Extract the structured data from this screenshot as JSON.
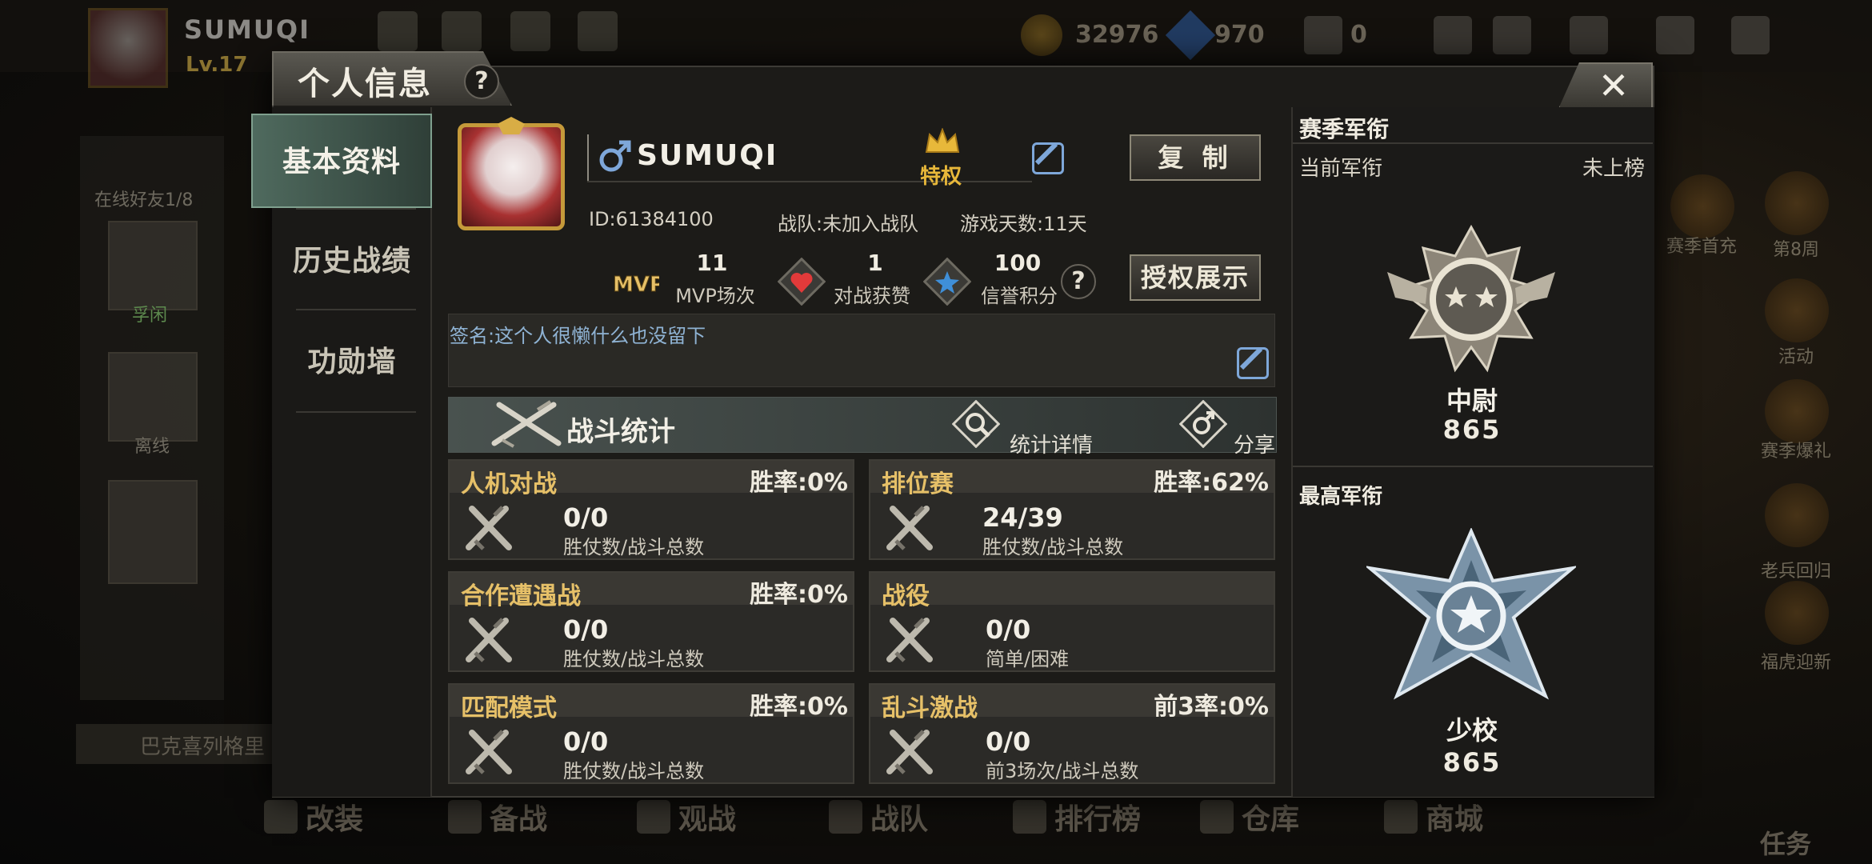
{
  "background": {
    "player_name": "SUMUQI",
    "level": "Lv.17",
    "gold": "32976",
    "diamonds": "970",
    "cards": "0",
    "online_friends": "在线好友1/8",
    "friend_labels": [
      "孚闲",
      "离线"
    ],
    "chat_preview": "巴克喜列格里",
    "right_events": [
      "赛季首充",
      "第8周",
      "活动",
      "赛季爆礼",
      "老兵回归",
      "福虎迎新"
    ],
    "bottom_nav": [
      "改装",
      "备战",
      "观战",
      "战队",
      "排行榜",
      "仓库",
      "商城"
    ],
    "task_label": "任务"
  },
  "modal": {
    "title": "个人信息",
    "help": "?",
    "close": "✕"
  },
  "tabs": [
    "基本资料",
    "历史战绩",
    "功勋墙"
  ],
  "profile": {
    "gender_symbol": "♂",
    "name": "SUMUQI",
    "privilege": "特权",
    "copy_button": "复 制",
    "id_text": "ID:61384100",
    "team_text": "战队:未加入战队",
    "days_text": "游戏天数:11天",
    "auth_button": "授权展示",
    "signature": "签名:这个人很懒什么也没留下"
  },
  "stats": [
    {
      "icon": "mvp-icon",
      "value": "11",
      "label": "MVP场次"
    },
    {
      "icon": "heart-icon",
      "value": "1",
      "label": "对战获赞"
    },
    {
      "icon": "star-icon",
      "value": "100",
      "label": "信誉积分"
    }
  ],
  "battle": {
    "title": "战斗统计",
    "detail": "统计详情",
    "share": "分享"
  },
  "modes": [
    {
      "name": "人机对战",
      "rate": "胜率:0%",
      "value": "0/0",
      "sub": "胜仗数/战斗总数"
    },
    {
      "name": "排位赛",
      "rate": "胜率:62%",
      "value": "24/39",
      "sub": "胜仗数/战斗总数"
    },
    {
      "name": "合作遭遇战",
      "rate": "胜率:0%",
      "value": "0/0",
      "sub": "胜仗数/战斗总数"
    },
    {
      "name": "战役",
      "rate": "",
      "value": "0/0",
      "sub": "简单/困难"
    },
    {
      "name": "匹配模式",
      "rate": "胜率:0%",
      "value": "0/0",
      "sub": "胜仗数/战斗总数"
    },
    {
      "name": "乱斗激战",
      "rate": "前3率:0%",
      "value": "0/0",
      "sub": "前3场次/战斗总数"
    }
  ],
  "rank": {
    "section_title": "赛季军衔",
    "current_label": "当前军衔",
    "current_status": "未上榜",
    "current_name": "中尉",
    "current_score": "865",
    "highest_label": "最高军衔",
    "highest_name": "少校",
    "highest_score": "865"
  },
  "colors": {
    "gold_text": "#e6c068",
    "blue_accent": "#7ea7d9",
    "active_tab": "#4f6a5e"
  }
}
